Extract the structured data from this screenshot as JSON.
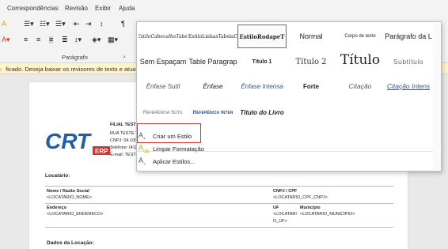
{
  "ribbon": {
    "tabs": [
      "Correspondências",
      "Revisão",
      "Exibir",
      "Ajuda"
    ],
    "group_paragraph": "Parágrafo",
    "notice": "ficado. Deseja baixar os revisores de texto e atualizações f"
  },
  "styles_gallery": {
    "row1": [
      "EstiloCabecalhoTabel",
      "EstiloLinhasTabelaC",
      "EstiloRodapeT",
      "Normal",
      "Corpo de texto",
      "Parágrafo da L"
    ],
    "row2": [
      "Sem Espaçam",
      "Table Paragrap",
      "Título 1",
      "Título 2",
      "Título",
      "Subtítulo"
    ],
    "row3": [
      "Ênfase Sutil",
      "Ênfase",
      "Ênfase Intensa",
      "Forte",
      "Citação",
      "Citação Intens"
    ],
    "row4": [
      "Referência Sutil",
      "Referência Inten",
      "Título do Livro"
    ],
    "actions": [
      {
        "label": "Criar um Estilo",
        "icon": "create-style-icon"
      },
      {
        "label": "Limpar Formatação",
        "icon": "clear-formatting-icon"
      },
      {
        "label": "Aplicar Estilos...",
        "icon": "apply-styles-icon"
      }
    ]
  },
  "document": {
    "company": "FILIAL TESTE",
    "address": "RUA TESTE TES",
    "cnpj": "CNPJ: 04.100.",
    "phone": "Telefone: (41) 3",
    "email": "E-mail: TESTE@",
    "logo_text": "CRT",
    "logo_sub": "ERP",
    "section_locatario": "Locatário:",
    "label_nome": "Nome / Razão Social",
    "value_nome": "<LOCATARIO_NOME>",
    "label_cnpj": "CNPJ / CPF",
    "value_cnpj": "<LOCATARIO_CPF_CNPJ>",
    "label_endereco": "Endereço",
    "value_endereco": "<LOCATARIO_ENDERECO>",
    "label_uf": "UF",
    "value_uf": "<LOCATARI",
    "value_uf2": "O_UF>",
    "label_municipio": "Município",
    "value_municipio": "<LOCATARIO_MUNICIPIO>",
    "section_locacao": "Dados da Locação:"
  },
  "colors": {
    "accent_red": "#d9322b",
    "logo_blue": "#1f5fa8",
    "notice_bg": "#fff4ce"
  }
}
